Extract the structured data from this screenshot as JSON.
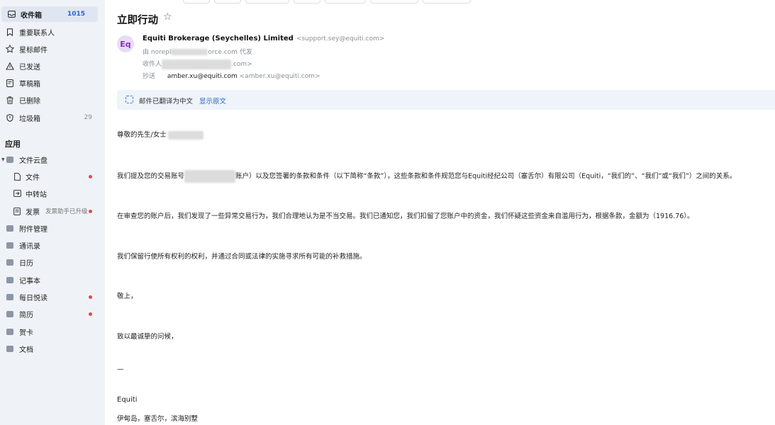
{
  "sidebar": {
    "folders": [
      {
        "label": "收件箱",
        "count": "1015",
        "icon": "inbox-icon"
      },
      {
        "label": "重要联系人",
        "icon": "bookmark-icon"
      },
      {
        "label": "星标邮件",
        "icon": "star-icon"
      },
      {
        "label": "已发送",
        "icon": "send-icon"
      },
      {
        "label": "草稿箱",
        "icon": "draft-icon"
      },
      {
        "label": "已删除",
        "icon": "trash-icon"
      },
      {
        "label": "垃圾箱",
        "count": "29",
        "icon": "shield-icon"
      }
    ],
    "apps_title": "应用",
    "apps": [
      {
        "label": "文件云盘",
        "icon": "cloud-drive-icon"
      },
      {
        "label": "文件",
        "icon": "file-icon"
      },
      {
        "label": "中转站",
        "icon": "transfer-icon"
      },
      {
        "label": "发票",
        "note": "发票助手已升级",
        "icon": "invoice-icon"
      },
      {
        "label": "附件管理",
        "icon": "attachment-icon"
      },
      {
        "label": "通讯录",
        "icon": "contacts-icon"
      },
      {
        "label": "日历",
        "icon": "calendar-icon"
      },
      {
        "label": "记事本",
        "icon": "notepad-icon"
      },
      {
        "label": "每日悦读",
        "icon": "reading-icon"
      },
      {
        "label": "简历",
        "icon": "resume-icon"
      },
      {
        "label": "贺卡",
        "icon": "card-icon"
      },
      {
        "label": "文档",
        "icon": "document-icon"
      }
    ]
  },
  "email": {
    "subject": "立即行动",
    "star_glyph": "☆",
    "avatar_text": "Eq",
    "sender_name": "Equiti Brokerage (Seychelles) Limited",
    "sender_email": "<support.sey@equiti.com>",
    "via_prefix": "由",
    "via_value": "norepl",
    "via_value_tail": "orce.com",
    "via_suffix": "代发",
    "to_label": "收件人",
    "to_tail": ".com>",
    "cc_label": "抄送",
    "cc_value": "amber.xu@equiti.com",
    "cc_email": "<amber.xu@equiti.com>",
    "translate_notice": "邮件已翻译为中文",
    "translate_link": "显示原文",
    "greeting": "尊敬的先生/女士",
    "para1_a": "我们提及您的交易账号",
    "para1_b": "账户）以及您签署的条款和条件（以下简称“条款”），这些条款和条件规范您与Equiti经纪公司（塞舌尔）有限公司（Equiti，“我们的”、“我们”或“我们”）之间的关系。",
    "para2": "在审查您的账户后，我们发现了一些异常交易行为，我们合理地认为是不当交易。我们已通知您，我们扣留了您账户中的资金，我们怀疑这些资金来自滥用行为，根据条款，金额为（1916.76）。",
    "para3": "我们保留行使所有权利的权利，并通过合同或法律的实施寻求所有可能的补救措施。",
    "closing1": "敬上，",
    "closing2": "致以最诚挚的问候，",
    "dash": "—",
    "sign_name": "Equiti",
    "sign_addr": "伊甸岛，塞舌尔，滨海别墅"
  }
}
